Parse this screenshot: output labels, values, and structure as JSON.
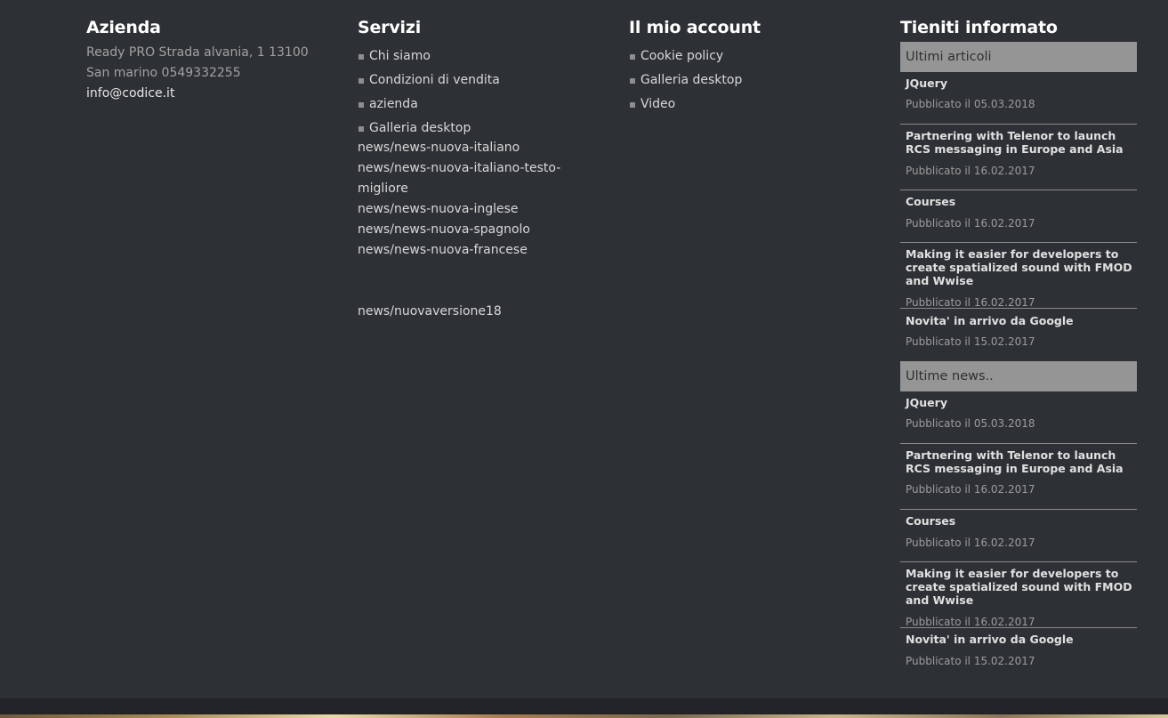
{
  "azienda": {
    "title": "Azienda",
    "address": "Ready PRO Strada alvania, 1 13100 San marino 0549332255",
    "email": "info@codice.it"
  },
  "servizi": {
    "title": "Servizi",
    "items": [
      "Chi siamo",
      "Condizioni di vendita",
      "azienda",
      "Galleria desktop"
    ],
    "links": [
      "news/news-nuova-italiano",
      "news/news-nuova-italiano-testo-migliore",
      "news/news-nuova-inglese",
      "news/news-nuova-spagnolo",
      "news/news-nuova-francese",
      "news/nuovaversione18"
    ]
  },
  "account": {
    "title": "Il mio account",
    "items": [
      "Cookie policy",
      "Galleria desktop",
      "Video"
    ]
  },
  "news": {
    "title": "Tieniti informato",
    "sections": [
      {
        "header": "Ultimi articoli",
        "articles": [
          {
            "title": "JQuery",
            "date": "Pubblicato il 05.03.2018"
          },
          {
            "title": "Partnering with Telenor to launch RCS messaging in Europe and Asia",
            "date": "Pubblicato il 16.02.2017"
          },
          {
            "title": "Courses",
            "date": "Pubblicato il 16.02.2017"
          },
          {
            "title": "Making it easier for developers to create spatialized sound with FMOD and Wwise",
            "date": "Pubblicato il 16.02.2017"
          },
          {
            "title": "Novita' in arrivo da Google",
            "date": "Pubblicato il 15.02.2017"
          }
        ]
      },
      {
        "header": "Ultime news..",
        "articles": [
          {
            "title": "JQuery",
            "date": "Pubblicato il 05.03.2018"
          },
          {
            "title": "Partnering with Telenor to launch RCS messaging in Europe and Asia",
            "date": "Pubblicato il 16.02.2017"
          },
          {
            "title": "Courses",
            "date": "Pubblicato il 16.02.2017"
          },
          {
            "title": "Making it easier for developers to create spatialized sound with FMOD and Wwise",
            "date": "Pubblicato il 16.02.2017"
          },
          {
            "title": "Novita' in arrivo da Google",
            "date": "Pubblicato il 15.02.2017"
          }
        ]
      }
    ]
  }
}
